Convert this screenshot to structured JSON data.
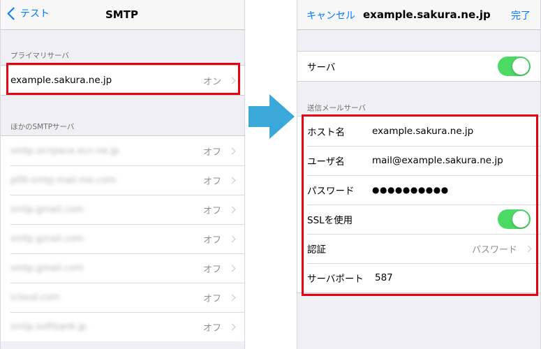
{
  "left": {
    "nav": {
      "back_label": "テスト",
      "title": "SMTP"
    },
    "primary_header": "プライマリサーバ",
    "primary_server": {
      "host": "example.sakura.ne.jp",
      "status": "オン"
    },
    "others_header": "ほかのSMTPサーバ",
    "other_servers": [
      {
        "host": "smtp.ocnpace.ocn.ne.jp",
        "status": "オフ"
      },
      {
        "host": "p06-smtp.mail.me.com",
        "status": "オフ"
      },
      {
        "host": "smtp.gmail.com",
        "status": "オフ"
      },
      {
        "host": "smtp.gmail.com",
        "status": "オフ"
      },
      {
        "host": "smtp.gmail.com",
        "status": "オフ"
      },
      {
        "host": "icloud.com",
        "status": "オフ"
      },
      {
        "host": "smtp.softbank.jp",
        "status": "オフ"
      }
    ]
  },
  "right": {
    "nav": {
      "cancel_label": "キャンセル",
      "title": "example.sakura.ne.jp",
      "done_label": "完了"
    },
    "server_label": "サーバ",
    "outgoing_header": "送信メールサーバ",
    "host": {
      "label": "ホスト名",
      "value": "example.sakura.ne.jp"
    },
    "username": {
      "label": "ユーザ名",
      "value": "mail@example.sakura.ne.jp"
    },
    "password": {
      "label": "パスワード",
      "value": "●●●●●●●●●●"
    },
    "ssl": {
      "label": "SSLを使用"
    },
    "auth": {
      "label": "認証",
      "value": "パスワード"
    },
    "port": {
      "label": "サーバポート",
      "value": "587"
    }
  },
  "colors": {
    "accent": "#007aff",
    "toggle_on": "#4cd964",
    "highlight": "#e50012",
    "arrow": "#3aa8d8"
  },
  "toggles": {
    "server_on": true,
    "ssl_on": true
  }
}
